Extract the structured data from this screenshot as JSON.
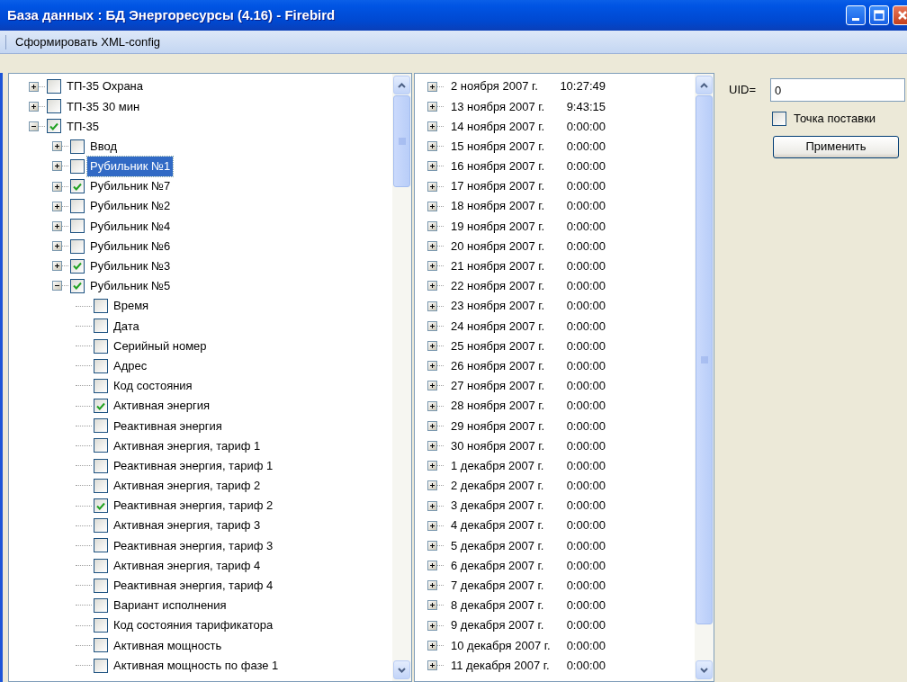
{
  "window": {
    "title": "База данных : БД Энергоресурсы (4.16) - Firebird"
  },
  "toolbar": {
    "items": [
      {
        "label": "Сформировать XML-config"
      }
    ]
  },
  "tree": {
    "items": [
      {
        "label": "ТП-35 Охрана",
        "checked": false,
        "selected": false,
        "expanded": false
      },
      {
        "label": "ТП-35 30 мин",
        "checked": false,
        "selected": false,
        "expanded": false
      },
      {
        "label": "ТП-35",
        "checked": true,
        "selected": false,
        "expanded": true,
        "children": [
          {
            "label": "Ввод",
            "checked": false,
            "selected": false,
            "expanded": false
          },
          {
            "label": "Рубильник №1",
            "checked": false,
            "selected": true,
            "expanded": false
          },
          {
            "label": "Рубильник №7",
            "checked": true,
            "selected": false,
            "expanded": false
          },
          {
            "label": "Рубильник №2",
            "checked": false,
            "selected": false,
            "expanded": false
          },
          {
            "label": "Рубильник №4",
            "checked": false,
            "selected": false,
            "expanded": false
          },
          {
            "label": "Рубильник №6",
            "checked": false,
            "selected": false,
            "expanded": false
          },
          {
            "label": "Рубильник №3",
            "checked": true,
            "selected": false,
            "expanded": false
          },
          {
            "label": "Рубильник №5",
            "checked": true,
            "selected": false,
            "expanded": true,
            "children": [
              {
                "label": "Время",
                "checked": false,
                "selected": false
              },
              {
                "label": "Дата",
                "checked": false,
                "selected": false
              },
              {
                "label": "Серийный номер",
                "checked": false,
                "selected": false
              },
              {
                "label": "Адрес",
                "checked": false,
                "selected": false
              },
              {
                "label": "Код состояния",
                "checked": false,
                "selected": false
              },
              {
                "label": "Активная энергия",
                "checked": true,
                "selected": false
              },
              {
                "label": "Реактивная энергия",
                "checked": false,
                "selected": false
              },
              {
                "label": "Активная энергия, тариф 1",
                "checked": false,
                "selected": false
              },
              {
                "label": "Реактивная энергия, тариф 1",
                "checked": false,
                "selected": false
              },
              {
                "label": "Активная энергия, тариф 2",
                "checked": false,
                "selected": false
              },
              {
                "label": "Реактивная энергия, тариф 2",
                "checked": true,
                "selected": false
              },
              {
                "label": "Активная энергия, тариф 3",
                "checked": false,
                "selected": false
              },
              {
                "label": "Реактивная энергия, тариф 3",
                "checked": false,
                "selected": false
              },
              {
                "label": "Активная энергия, тариф 4",
                "checked": false,
                "selected": false
              },
              {
                "label": "Реактивная энергия, тариф 4",
                "checked": false,
                "selected": false
              },
              {
                "label": "Вариант исполнения",
                "checked": false,
                "selected": false
              },
              {
                "label": "Код состояния тарификатора",
                "checked": false,
                "selected": false
              },
              {
                "label": "Активная мощность",
                "checked": false,
                "selected": false
              },
              {
                "label": "Активная мощность по фазе 1",
                "checked": false,
                "selected": false
              }
            ]
          }
        ]
      }
    ]
  },
  "dates": {
    "items": [
      {
        "date": "2 ноября 2007 г.",
        "time": "10:27:49",
        "expanded": false
      },
      {
        "date": "13 ноября 2007 г.",
        "time": "9:43:15",
        "expanded": false
      },
      {
        "date": "14 ноября 2007 г.",
        "time": "0:00:00",
        "expanded": false
      },
      {
        "date": "15 ноября 2007 г.",
        "time": "0:00:00",
        "expanded": false
      },
      {
        "date": "16 ноября 2007 г.",
        "time": "0:00:00",
        "expanded": false
      },
      {
        "date": "17 ноября 2007 г.",
        "time": "0:00:00",
        "expanded": false
      },
      {
        "date": "18 ноября 2007 г.",
        "time": "0:00:00",
        "expanded": false
      },
      {
        "date": "19 ноября 2007 г.",
        "time": "0:00:00",
        "expanded": false
      },
      {
        "date": "20 ноября 2007 г.",
        "time": "0:00:00",
        "expanded": false
      },
      {
        "date": "21 ноября 2007 г.",
        "time": "0:00:00",
        "expanded": false
      },
      {
        "date": "22 ноября 2007 г.",
        "time": "0:00:00",
        "expanded": false
      },
      {
        "date": "23 ноября 2007 г.",
        "time": "0:00:00",
        "expanded": false
      },
      {
        "date": "24 ноября 2007 г.",
        "time": "0:00:00",
        "expanded": false
      },
      {
        "date": "25 ноября 2007 г.",
        "time": "0:00:00",
        "expanded": false
      },
      {
        "date": "26 ноября 2007 г.",
        "time": "0:00:00",
        "expanded": false
      },
      {
        "date": "27 ноября 2007 г.",
        "time": "0:00:00",
        "expanded": false
      },
      {
        "date": "28 ноября 2007 г.",
        "time": "0:00:00",
        "expanded": false
      },
      {
        "date": "29 ноября 2007 г.",
        "time": "0:00:00",
        "expanded": false
      },
      {
        "date": "30 ноября 2007 г.",
        "time": "0:00:00",
        "expanded": false
      },
      {
        "date": "1 декабря 2007 г.",
        "time": "0:00:00",
        "expanded": false
      },
      {
        "date": "2 декабря 2007 г.",
        "time": "0:00:00",
        "expanded": false
      },
      {
        "date": "3 декабря 2007 г.",
        "time": "0:00:00",
        "expanded": false
      },
      {
        "date": "4 декабря 2007 г.",
        "time": "0:00:00",
        "expanded": false
      },
      {
        "date": "5 декабря 2007 г.",
        "time": "0:00:00",
        "expanded": false
      },
      {
        "date": "6 декабря 2007 г.",
        "time": "0:00:00",
        "expanded": false
      },
      {
        "date": "7 декабря 2007 г.",
        "time": "0:00:00",
        "expanded": false
      },
      {
        "date": "8 декабря 2007 г.",
        "time": "0:00:00",
        "expanded": false
      },
      {
        "date": "9 декабря 2007 г.",
        "time": "0:00:00",
        "expanded": false
      },
      {
        "date": "10 декабря 2007 г.",
        "time": "0:00:00",
        "expanded": false
      },
      {
        "date": "11 декабря 2007 г.",
        "time": "0:00:00",
        "expanded": false
      }
    ]
  },
  "properties": {
    "uid_label": "UID=",
    "uid_value": "0",
    "delivery_point": {
      "label": "Точка поставки",
      "checked": false
    },
    "apply_button": "Применить"
  }
}
